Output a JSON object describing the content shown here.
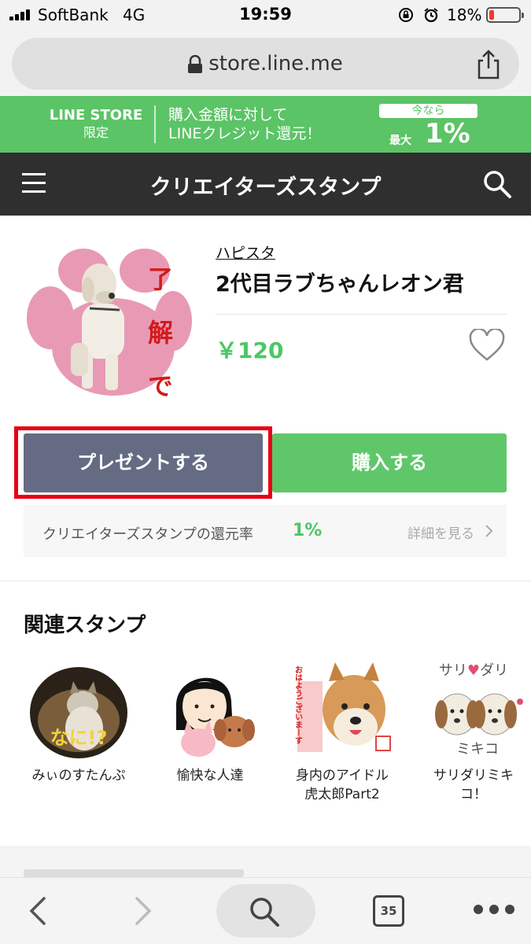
{
  "status_bar": {
    "carrier": "SoftBank",
    "network": "4G",
    "time": "19:59",
    "battery_pct": "18%",
    "battery_level": 0.18
  },
  "url_bar": {
    "url": "store.line.me"
  },
  "promo": {
    "brand": "LINE STORE",
    "brand_sub": "限定",
    "line1": "購入金額に対して",
    "line2": "LINEクレジット還元！",
    "tag": "今なら",
    "max_label": "最大",
    "pct": "1%"
  },
  "nav": {
    "title": "クリエイターズスタンプ"
  },
  "product": {
    "sticker_text": "了解です",
    "creator": "ハピスタ",
    "title": "2代目ラブちゃんレオン君",
    "price": "￥120",
    "gift_label": "プレゼントする",
    "buy_label": "購入する",
    "rebate_label": "クリエイターズスタンプの還元率",
    "rebate_pct": "1%",
    "details_link": "詳細を見る"
  },
  "related": {
    "title": "関連スタンプ",
    "items": [
      {
        "name": "みぃのすたんぷ",
        "name2": "",
        "caption": "なに!?"
      },
      {
        "name": "愉快な人達",
        "name2": "",
        "caption": ""
      },
      {
        "name": "身内のアイドル",
        "name2": "虎太郎Part2",
        "caption": "おはようございまーす"
      },
      {
        "name": "サリダリミキ",
        "name2": "コ！",
        "caption": "サリ♥ダリ ミキコ"
      }
    ]
  },
  "toolbar": {
    "tab_count": "35"
  },
  "colors": {
    "line_green": "#5bc466",
    "price_green": "#4cc764",
    "gift_gray": "#656b83",
    "highlight_red": "#e60012",
    "nav_dark": "#2f2f2f"
  }
}
